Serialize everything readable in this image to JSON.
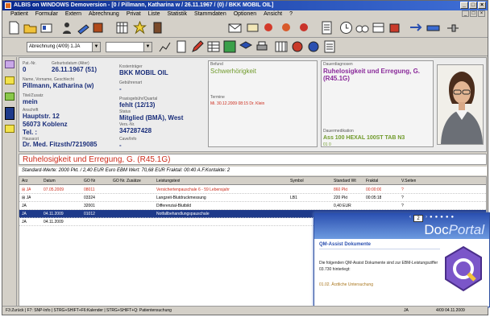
{
  "window": {
    "title": "ALBIS on WINDOWS Demoversion - [0 / Pillmann, Katharina w / 26.11.1967 / (0) / BKK MOBIL OIL]",
    "controls": [
      "_",
      "□",
      "×"
    ],
    "mdi_controls": [
      "_",
      "□",
      "×"
    ]
  },
  "menu": [
    "Patient",
    "Formular",
    "Extern",
    "Abrechnung",
    "Privat",
    "Liste",
    "Statistik",
    "Stammdaten",
    "Optionen",
    "Ansicht",
    "?"
  ],
  "toolbar2": {
    "abrechnung_combo": "Abrechnung (4/09) 1.JA",
    "blank_combo": "",
    "dropdown_arrow": "▼"
  },
  "patient": {
    "pat_nr_label": "Pat.-Nr.",
    "pat_nr": "0",
    "geburtsdatum_label": "Geburtsdatum (Alter)",
    "geburtsdatum": "26.11.1967 (51)",
    "name_label": "Name, Vorname, Geschlecht",
    "name": "Pillmann, Katharina (w)",
    "titel_label": "Titel/Zusatz",
    "titel": "mein",
    "anschrift_label": "Anschrift",
    "strasse": "Hauptstr. 12",
    "ort": "56073 Koblenz",
    "tel": "Tel. :",
    "hausarzt_label": "Hausarzt",
    "hausarzt": "Dr. Med. Fitzsth/7219085",
    "kasse_label": "Kostenträger",
    "kasse": "BKK MOBIL OIL",
    "gebuehr_label": "Gebührenart",
    "gebuehr": "-",
    "praxisgebuehr_label": "Praxisgebühr/Quartal",
    "praxisgebuehr": "fehlt (12/13)",
    "status_label": "Status",
    "status": "Mitglied (BMÄ), West",
    "vers_nr_label": "Vers.-Nr.",
    "vers_nr": "347287428",
    "cave_label": "Cave/Info",
    "cave": "-",
    "befund_label": "Befund",
    "befund": "Schwerhörigkeit",
    "termine_label": "Termine",
    "termin": "Mi. 30.12.2009 08:15 Dr. Klein",
    "dauerdiagnosen_label": "Dauerdiagnosen",
    "dauerdiagnose": "Ruhelosigkeit und Erregung, G. (R45.1G)",
    "dauermedikation_label": "Dauermedikation",
    "dauermedikation": "Ass 100 HEXAL 100ST TAB N3",
    "dauermedikation_more": "01 0"
  },
  "diagnosis_bar": "Ruhelosigkeit und Erregung, G. (R45.1G)",
  "info_bar": "Standard-Werte: 2000 Pkt. / 2,40 EUR    Euro EBM Wert: 70,68 EUR    Fraktal: 00:40    A.F.Kontakte: 2",
  "grid": {
    "columns": [
      "Arz",
      "Datum",
      "GO Nr",
      "GO Nr. Zusätze",
      "Leistungstext",
      "Symbol",
      "Standard Wt",
      "Fraktal",
      "V.Seiten"
    ],
    "rows": [
      {
        "arzt": "⊞ JA",
        "datum": "07.05.2009",
        "gonr": "08011",
        "zusatz": "",
        "text": "Versichertenpauschale 6 - 59 Lebensjahr",
        "symbol": "",
        "wert": "860 Pkt",
        "fraktal": "00:00:00",
        "vs": "?",
        "style": "red"
      },
      {
        "arzt": "⊞ JA",
        "datum": "",
        "gonr": "03324",
        "zusatz": "",
        "text": "Langzeit-Blutdruckmessung",
        "symbol": "LB1",
        "wert": "220 Pkt",
        "fraktal": "00:05:18",
        "vs": "?",
        "style": "normal"
      },
      {
        "arzt": "JA",
        "datum": "",
        "gonr": "32001",
        "zusatz": "",
        "text": "Differenzial-Blutbild",
        "symbol": "",
        "wert": "0,40 EUR",
        "fraktal": "",
        "vs": "?",
        "style": "normal"
      },
      {
        "arzt": "JA",
        "datum": "04.11.2009",
        "gonr": "01012",
        "zusatz": "",
        "text": "Notfallbehandlungspauschale",
        "symbol": "",
        "wert": "",
        "fraktal": "",
        "vs": "",
        "style": "selected"
      },
      {
        "arzt": "JA",
        "datum": "04.11.2009",
        "gonr": "",
        "zusatz": "",
        "text": "",
        "symbol": "",
        "wert": "",
        "fraktal": "",
        "vs": "",
        "style": "normal"
      }
    ]
  },
  "docportal": {
    "page": "2",
    "nav_prev": "‹",
    "nav_next": "›",
    "brand_prefix": "Doc",
    "brand_suffix": "Portal",
    "heading": "QM-Assist Dokumente",
    "body": "Die folgenden QM-Assist Dokumente sind zur EBM-Leistungsziffer 03.730 hinterlegt:",
    "link": "01.02. Ärztliche Untersuchung"
  },
  "statusbar": {
    "hint": "F3:Zurück | F7: SNP-Info | STRG+SHIFT+F6:Kalender | STRG+SHIFT+Q: Patientensuchung",
    "user": "JA",
    "datetime": "4/09 04.11.2009"
  },
  "colors": {
    "accent_blue": "#1a2e7a",
    "red_text": "#cc2b1b",
    "green_text": "#6f9a2a",
    "selection": "#1e3a8a",
    "docportal_blue": "#2a4fb0"
  }
}
